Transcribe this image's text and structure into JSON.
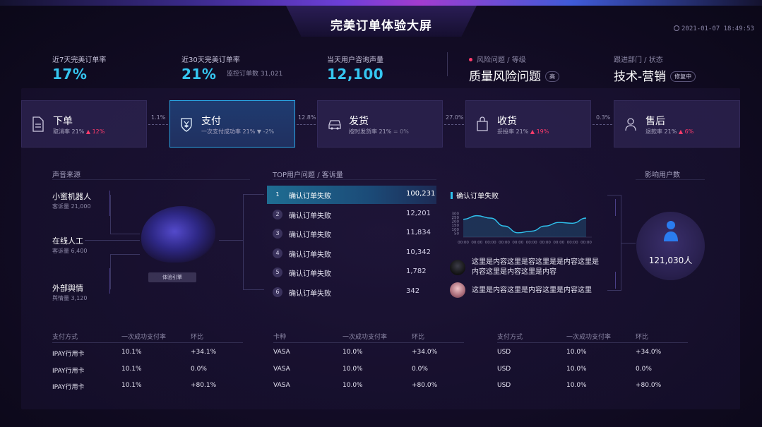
{
  "header": {
    "title": "完美订单体验大屏",
    "datetime": "2021-01-07 18:49:53"
  },
  "kpis": [
    {
      "label": "近7天完美订单率",
      "value": "17%",
      "sub": ""
    },
    {
      "label": "近30天完美订单率",
      "value": "21%",
      "sub": "监控订单数 31,021"
    },
    {
      "label": "当天用户咨询声量",
      "value": "12,100",
      "sub": ""
    }
  ],
  "risk": {
    "label": "风险问题 / 等级",
    "value": "质量风险问题",
    "tag": "高"
  },
  "dept": {
    "label": "跟进部门 / 状态",
    "value": "技术-营销",
    "tag": "修复中"
  },
  "steps": [
    {
      "name": "下单",
      "rate": "取消率 21%",
      "change": "12%",
      "trend": "up",
      "icon": "document-icon"
    },
    {
      "name": "支付",
      "rate": "一次支付成功率 21%",
      "change": "-2%",
      "trend": "down",
      "icon": "yen-shield-icon"
    },
    {
      "name": "发货",
      "rate": "按时发货率 21%",
      "change": "0%",
      "trend": "flat",
      "icon": "car-icon"
    },
    {
      "name": "收货",
      "rate": "妥投率 21%",
      "change": "19%",
      "trend": "up",
      "icon": "bag-icon"
    },
    {
      "name": "售后",
      "rate": "退款率 21%",
      "change": "6%",
      "trend": "up",
      "icon": "person-icon"
    }
  ],
  "step_connectors": [
    "1.1%",
    "12.8%",
    "27.0%",
    "0.3%"
  ],
  "voice_sources": {
    "title": "声音来源",
    "items": [
      {
        "name": "小蜜机器人",
        "sub": "客诉量 21,000"
      },
      {
        "name": "在线人工",
        "sub": "客诉量 6,400"
      },
      {
        "name": "外部舆情",
        "sub": "舆情量 3,120"
      }
    ],
    "engine": "体验引擎"
  },
  "top_issues": {
    "title": "TOP用户问题 / 客诉量",
    "rows": [
      {
        "rank": "1",
        "label": "确认订单失败",
        "value": "100,231"
      },
      {
        "rank": "2",
        "label": "确认订单失败",
        "value": "12,201"
      },
      {
        "rank": "3",
        "label": "确认订单失败",
        "value": "11,834"
      },
      {
        "rank": "4",
        "label": "确认订单失败",
        "value": "10,342"
      },
      {
        "rank": "5",
        "label": "确认订单失败",
        "value": "1,782"
      },
      {
        "rank": "6",
        "label": "确认订单失败",
        "value": "342"
      }
    ]
  },
  "chart_data": {
    "type": "area",
    "title": "确认订单失败",
    "x": [
      "00:00",
      "00:00",
      "00:00",
      "00:00",
      "00:00",
      "00:00",
      "00:00",
      "00:00",
      "00:00",
      "00:00"
    ],
    "yticks": [
      "300",
      "250",
      "200",
      "150",
      "100",
      "50"
    ],
    "ylim": [
      0,
      320
    ],
    "series": [
      {
        "values": [
          225,
          270,
          240,
          140,
          55,
          75,
          140,
          185,
          175,
          240
        ]
      }
    ],
    "color": "#2fc2ee"
  },
  "comments": [
    "这里是内容这里是容这里是是内容这里是内容这里是内容这里是内容",
    "这里是内容这里是内容这里是内容这里"
  ],
  "impact": {
    "title": "影响用户数",
    "value": "121,030人"
  },
  "tables": [
    {
      "headers": [
        "支付方式",
        "一次成功支付率",
        "环比"
      ],
      "rows": [
        [
          "IPAY行用卡",
          "10.1%",
          "+34.1%"
        ],
        [
          "IPAY行用卡",
          "10.1%",
          "0.0%"
        ],
        [
          "IPAY行用卡",
          "10.1%",
          "+80.1%"
        ]
      ]
    },
    {
      "headers": [
        "卡种",
        "一次成功支付率",
        "环比"
      ],
      "rows": [
        [
          "VASA",
          "10.0%",
          "+34.0%"
        ],
        [
          "VASA",
          "10.0%",
          "0.0%"
        ],
        [
          "VASA",
          "10.0%",
          "+80.0%"
        ]
      ]
    },
    {
      "headers": [
        "支付方式",
        "一次成功支付率",
        "环比"
      ],
      "rows": [
        [
          "USD",
          "10.0%",
          "+34.0%"
        ],
        [
          "USD",
          "10.0%",
          "0.0%"
        ],
        [
          "USD",
          "10.0%",
          "+80.0%"
        ]
      ]
    }
  ]
}
